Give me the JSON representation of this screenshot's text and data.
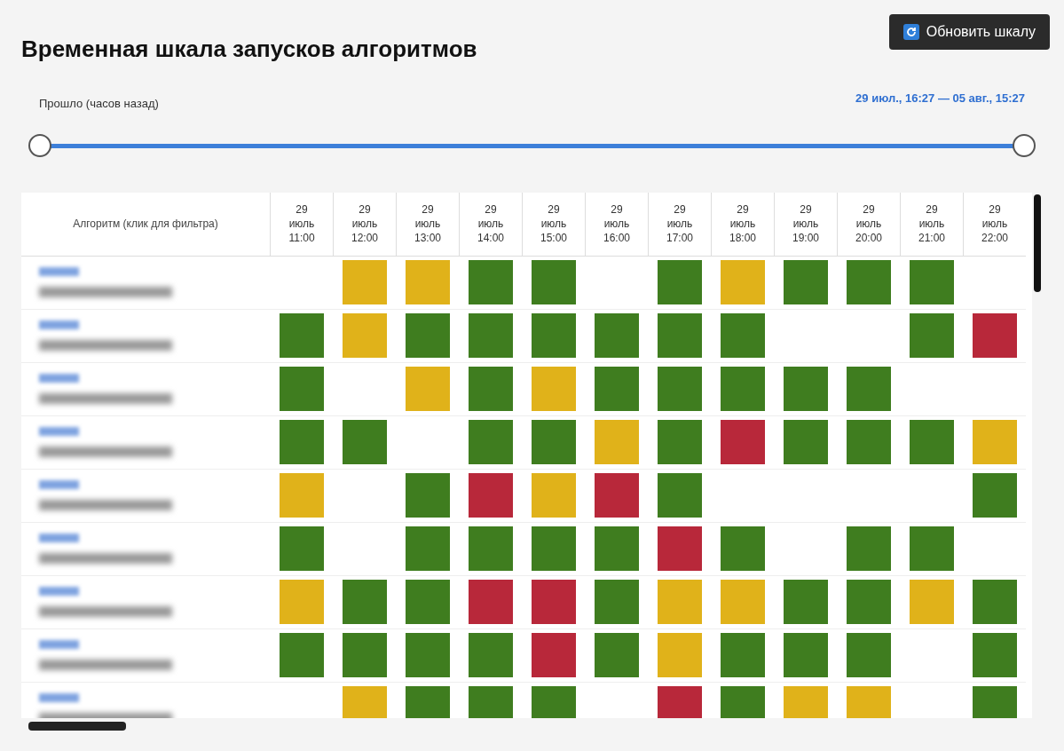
{
  "title": "Временная шкала запусков алгоритмов",
  "refresh_button": {
    "label": "Обновить шкалу"
  },
  "range": {
    "label": "Прошло (часов назад)",
    "value": "29 июл., 16:27 — 05 авг., 15:27",
    "thumbs": [
      {
        "level": 0
      },
      {
        "level": 1
      }
    ]
  },
  "table": {
    "first_column": "Алгоритм (клик для фильтра)",
    "columns": [
      {
        "day": "29",
        "month": "июль",
        "time": "11:00"
      },
      {
        "day": "29",
        "month": "июль",
        "time": "12:00"
      },
      {
        "day": "29",
        "month": "июль",
        "time": "13:00"
      },
      {
        "day": "29",
        "month": "июль",
        "time": "14:00"
      },
      {
        "day": "29",
        "month": "июль",
        "time": "15:00"
      },
      {
        "day": "29",
        "month": "июль",
        "time": "16:00"
      },
      {
        "day": "29",
        "month": "июль",
        "time": "17:00"
      },
      {
        "day": "29",
        "month": "июль",
        "time": "18:00"
      },
      {
        "day": "29",
        "month": "июль",
        "time": "19:00"
      },
      {
        "day": "29",
        "month": "июль",
        "time": "20:00"
      },
      {
        "day": "29",
        "month": "июль",
        "time": "21:00"
      },
      {
        "day": "29",
        "month": "июль",
        "time": "22:00"
      }
    ],
    "rows": [
      {
        "cells": [
          {
            "kind": "empty"
          },
          {
            "kind": "warning"
          },
          {
            "kind": "warning"
          },
          {
            "kind": "success"
          },
          {
            "kind": "success"
          },
          {
            "kind": "empty"
          },
          {
            "kind": "success"
          },
          {
            "kind": "warning"
          },
          {
            "kind": "success"
          },
          {
            "kind": "success"
          },
          {
            "kind": "success"
          },
          {
            "kind": "empty"
          }
        ]
      },
      {
        "cells": [
          {
            "kind": "success"
          },
          {
            "kind": "warning"
          },
          {
            "kind": "success"
          },
          {
            "kind": "success"
          },
          {
            "kind": "success"
          },
          {
            "kind": "success"
          },
          {
            "kind": "success"
          },
          {
            "kind": "success"
          },
          {
            "kind": "empty"
          },
          {
            "kind": "empty"
          },
          {
            "kind": "success"
          },
          {
            "kind": "error"
          }
        ]
      },
      {
        "cells": [
          {
            "kind": "success"
          },
          {
            "kind": "empty"
          },
          {
            "kind": "warning"
          },
          {
            "kind": "success"
          },
          {
            "kind": "warning"
          },
          {
            "kind": "success"
          },
          {
            "kind": "success"
          },
          {
            "kind": "success"
          },
          {
            "kind": "success"
          },
          {
            "kind": "success"
          },
          {
            "kind": "empty"
          },
          {
            "kind": "empty"
          }
        ]
      },
      {
        "cells": [
          {
            "kind": "success"
          },
          {
            "kind": "success"
          },
          {
            "kind": "empty"
          },
          {
            "kind": "success"
          },
          {
            "kind": "success"
          },
          {
            "kind": "warning"
          },
          {
            "kind": "success"
          },
          {
            "kind": "error"
          },
          {
            "kind": "success"
          },
          {
            "kind": "success"
          },
          {
            "kind": "success"
          },
          {
            "kind": "warning"
          }
        ]
      },
      {
        "cells": [
          {
            "kind": "warning"
          },
          {
            "kind": "empty"
          },
          {
            "kind": "success"
          },
          {
            "kind": "error"
          },
          {
            "kind": "warning"
          },
          {
            "kind": "error"
          },
          {
            "kind": "success"
          },
          {
            "kind": "empty"
          },
          {
            "kind": "empty"
          },
          {
            "kind": "empty"
          },
          {
            "kind": "empty"
          },
          {
            "kind": "success"
          }
        ]
      },
      {
        "cells": [
          {
            "kind": "success"
          },
          {
            "kind": "empty"
          },
          {
            "kind": "success"
          },
          {
            "kind": "success"
          },
          {
            "kind": "success"
          },
          {
            "kind": "success"
          },
          {
            "kind": "error"
          },
          {
            "kind": "success"
          },
          {
            "kind": "empty"
          },
          {
            "kind": "success"
          },
          {
            "kind": "success"
          },
          {
            "kind": "empty"
          }
        ]
      },
      {
        "cells": [
          {
            "kind": "warning"
          },
          {
            "kind": "success"
          },
          {
            "kind": "success"
          },
          {
            "kind": "error"
          },
          {
            "kind": "error"
          },
          {
            "kind": "success"
          },
          {
            "kind": "warning"
          },
          {
            "kind": "warning"
          },
          {
            "kind": "success"
          },
          {
            "kind": "success"
          },
          {
            "kind": "warning"
          },
          {
            "kind": "success"
          }
        ]
      },
      {
        "cells": [
          {
            "kind": "success"
          },
          {
            "kind": "success"
          },
          {
            "kind": "success"
          },
          {
            "kind": "success"
          },
          {
            "kind": "error"
          },
          {
            "kind": "success"
          },
          {
            "kind": "warning"
          },
          {
            "kind": "success"
          },
          {
            "kind": "success"
          },
          {
            "kind": "success"
          },
          {
            "kind": "empty"
          },
          {
            "kind": "success"
          }
        ]
      },
      {
        "cells": [
          {
            "kind": "empty"
          },
          {
            "kind": "warning"
          },
          {
            "kind": "success"
          },
          {
            "kind": "success"
          },
          {
            "kind": "success"
          },
          {
            "kind": "empty"
          },
          {
            "kind": "error"
          },
          {
            "kind": "success"
          },
          {
            "kind": "warning"
          },
          {
            "kind": "warning"
          },
          {
            "kind": "empty"
          },
          {
            "kind": "success"
          }
        ]
      }
    ]
  }
}
